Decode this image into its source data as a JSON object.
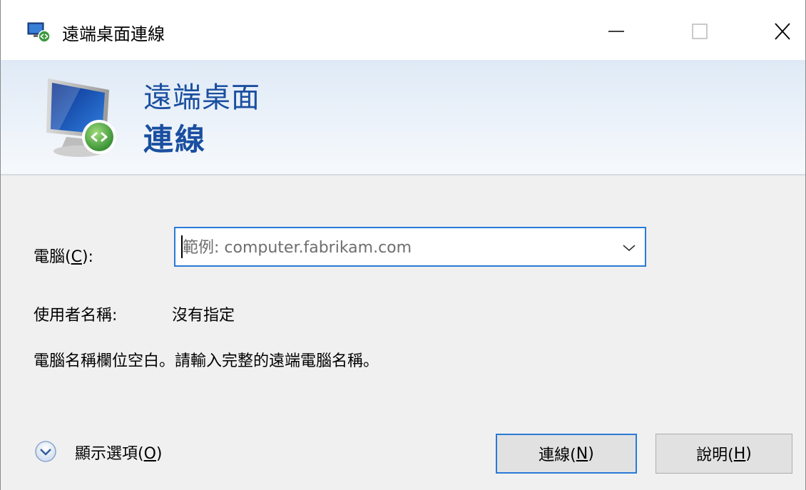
{
  "window": {
    "title": "遠端桌面連線",
    "app_icon": "remote-desktop-icon"
  },
  "titlebar_buttons": {
    "minimize": "minimize-icon",
    "maximize": "maximize-icon",
    "close": "close-icon"
  },
  "banner": {
    "line1": "遠端桌面",
    "line2": "連線"
  },
  "form": {
    "computer_label_prefix": "電腦(",
    "computer_label_key": "C",
    "computer_label_suffix": "):",
    "computer_placeholder": "範例: computer.fabrikam.com",
    "computer_value": "",
    "user_label": "使用者名稱:",
    "user_value": "沒有指定",
    "message": "電腦名稱欄位空白。請輸入完整的遠端電腦名稱。"
  },
  "options": {
    "label_prefix": "顯示選項(",
    "label_key": "O",
    "label_suffix": ")",
    "icon": "chevron-down-circle-icon"
  },
  "buttons": {
    "connect_prefix": "連線(",
    "connect_key": "N",
    "connect_suffix": ")",
    "help_prefix": "說明(",
    "help_key": "H",
    "help_suffix": ")"
  },
  "colors": {
    "accent": "#2a7ad6",
    "banner_text": "#1a4fa0"
  }
}
